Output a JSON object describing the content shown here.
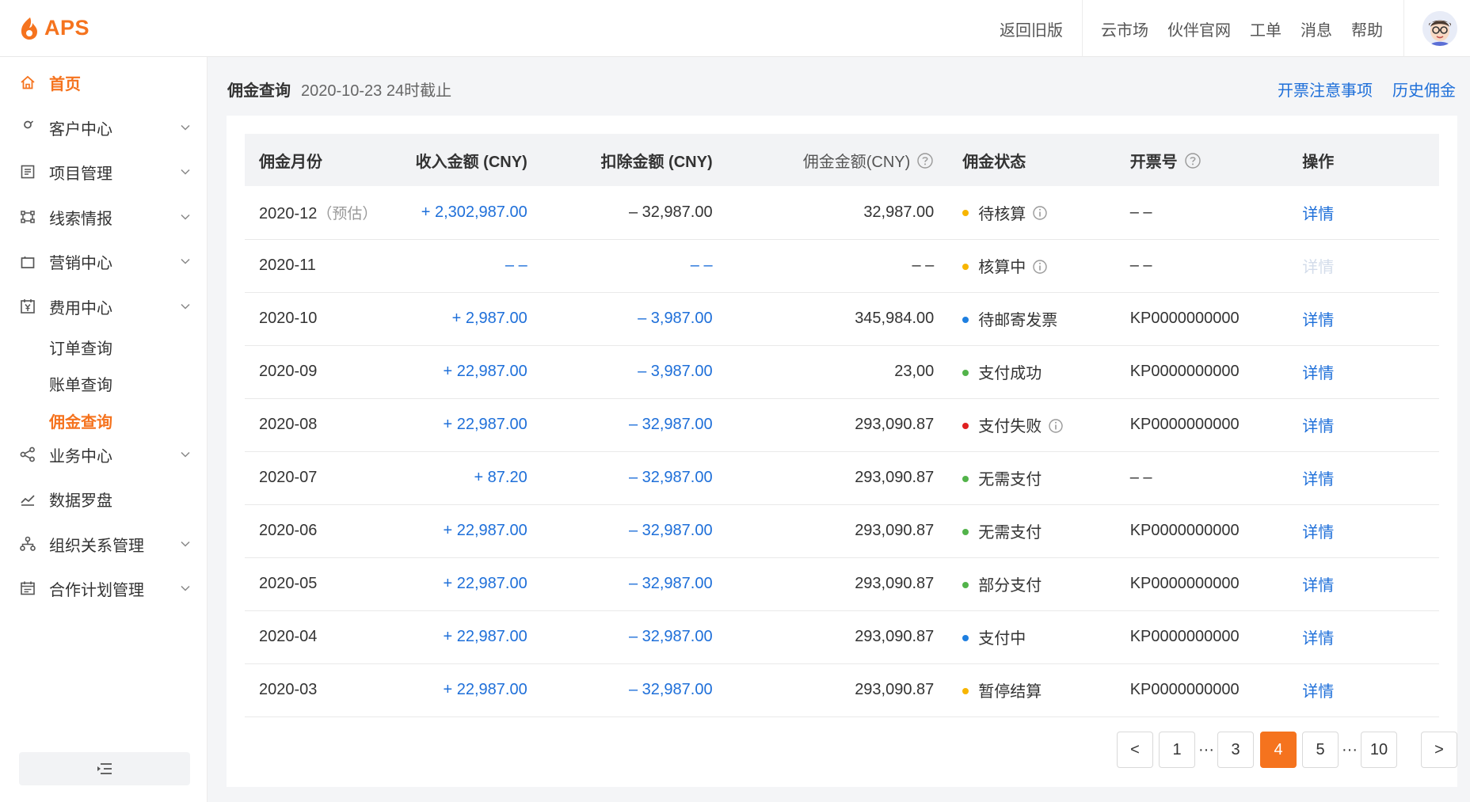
{
  "brand": {
    "name": "APS",
    "color": "#f5731e"
  },
  "topbar": {
    "back_old": "返回旧版",
    "links": [
      "云市场",
      "伙伴官网",
      "工单",
      "消息",
      "帮助"
    ]
  },
  "sidebar": {
    "items": [
      {
        "label": "首页",
        "icon": "home-icon",
        "active": true,
        "expandable": false
      },
      {
        "label": "客户中心",
        "icon": "user-icon",
        "active": false,
        "expandable": true
      },
      {
        "label": "项目管理",
        "icon": "list-icon",
        "active": false,
        "expandable": true
      },
      {
        "label": "线索情报",
        "icon": "link-nodes-icon",
        "active": false,
        "expandable": true
      },
      {
        "label": "营销中心",
        "icon": "shopping-bag-icon",
        "active": false,
        "expandable": true
      },
      {
        "label": "费用中心",
        "icon": "yen-icon",
        "active": false,
        "expandable": true
      },
      {
        "label": "业务中心",
        "icon": "share-icon",
        "active": false,
        "expandable": true
      },
      {
        "label": "数据罗盘",
        "icon": "trend-chart-icon",
        "active": false,
        "expandable": false
      },
      {
        "label": "组织关系管理",
        "icon": "org-icon",
        "active": false,
        "expandable": true
      },
      {
        "label": "合作计划管理",
        "icon": "calendar-icon",
        "active": false,
        "expandable": true
      }
    ],
    "sub_items": [
      {
        "label": "订单查询",
        "active": false
      },
      {
        "label": "账单查询",
        "active": false
      },
      {
        "label": "佣金查询",
        "active": true
      }
    ]
  },
  "page": {
    "title": "佣金查询",
    "subtitle": "2020-10-23 24时截止",
    "links": [
      "开票注意事项",
      "历史佣金"
    ]
  },
  "table": {
    "columns": {
      "month": "佣金月份",
      "income": "收入金额 (CNY)",
      "deduct": "扣除金额 (CNY)",
      "commission": "佣金金额(CNY)",
      "status": "佣金状态",
      "invoice": "开票号",
      "action": "操作"
    },
    "estimate_tag": "（预估）",
    "detail_label": "详情",
    "rows": [
      {
        "month": "2020-12",
        "estimate": true,
        "income": "+ 2,302,987.00",
        "deduct": "– 32,987.00",
        "deduct_blue": false,
        "commission": "32,987.00",
        "status": "待核算",
        "status_color": "#f7b500",
        "status_info": true,
        "invoice": "– –",
        "detail_enabled": true
      },
      {
        "month": "2020-11",
        "estimate": false,
        "income": "– –",
        "deduct": "– –",
        "deduct_blue": true,
        "commission": "– –",
        "status": "核算中",
        "status_color": "#f7b500",
        "status_info": true,
        "invoice": "– –",
        "detail_enabled": false
      },
      {
        "month": "2020-10",
        "estimate": false,
        "income": "+ 2,987.00",
        "deduct": "– 3,987.00",
        "deduct_blue": true,
        "commission": "345,984.00",
        "status": "待邮寄发票",
        "status_color": "#1e7fe0",
        "status_info": false,
        "invoice": "KP0000000000",
        "detail_enabled": true
      },
      {
        "month": "2020-09",
        "estimate": false,
        "income": "+ 22,987.00",
        "deduct": "– 3,987.00",
        "deduct_blue": true,
        "commission": "23,00",
        "status": "支付成功",
        "status_color": "#52b34a",
        "status_info": false,
        "invoice": "KP0000000000",
        "detail_enabled": true
      },
      {
        "month": "2020-08",
        "estimate": false,
        "income": "+ 22,987.00",
        "deduct": "– 32,987.00",
        "deduct_blue": true,
        "commission": "293,090.87",
        "status": "支付失败",
        "status_color": "#e02020",
        "status_info": true,
        "invoice": "KP0000000000",
        "detail_enabled": true
      },
      {
        "month": "2020-07",
        "estimate": false,
        "income": "+ 87.20",
        "deduct": "– 32,987.00",
        "deduct_blue": true,
        "commission": "293,090.87",
        "status": "无需支付",
        "status_color": "#52b34a",
        "status_info": false,
        "invoice": "– –",
        "detail_enabled": true
      },
      {
        "month": "2020-06",
        "estimate": false,
        "income": "+ 22,987.00",
        "deduct": "– 32,987.00",
        "deduct_blue": true,
        "commission": "293,090.87",
        "status": "无需支付",
        "status_color": "#52b34a",
        "status_info": false,
        "invoice": "KP0000000000",
        "detail_enabled": true
      },
      {
        "month": "2020-05",
        "estimate": false,
        "income": "+ 22,987.00",
        "deduct": "– 32,987.00",
        "deduct_blue": true,
        "commission": "293,090.87",
        "status": "部分支付",
        "status_color": "#52b34a",
        "status_info": false,
        "invoice": "KP0000000000",
        "detail_enabled": true
      },
      {
        "month": "2020-04",
        "estimate": false,
        "income": "+ 22,987.00",
        "deduct": "– 32,987.00",
        "deduct_blue": true,
        "commission": "293,090.87",
        "status": "支付中",
        "status_color": "#1e7fe0",
        "status_info": false,
        "invoice": "KP0000000000",
        "detail_enabled": true
      },
      {
        "month": "2020-03",
        "estimate": false,
        "income": "+ 22,987.00",
        "deduct": "– 32,987.00",
        "deduct_blue": true,
        "commission": "293,090.87",
        "status": "暂停结算",
        "status_color": "#f7b500",
        "status_info": false,
        "invoice": "KP0000000000",
        "detail_enabled": true
      }
    ]
  },
  "pagination": {
    "prev": "<",
    "next": ">",
    "ellipsis": "···",
    "pages": [
      "1",
      "3",
      "4",
      "5",
      "10"
    ],
    "current": "4"
  }
}
